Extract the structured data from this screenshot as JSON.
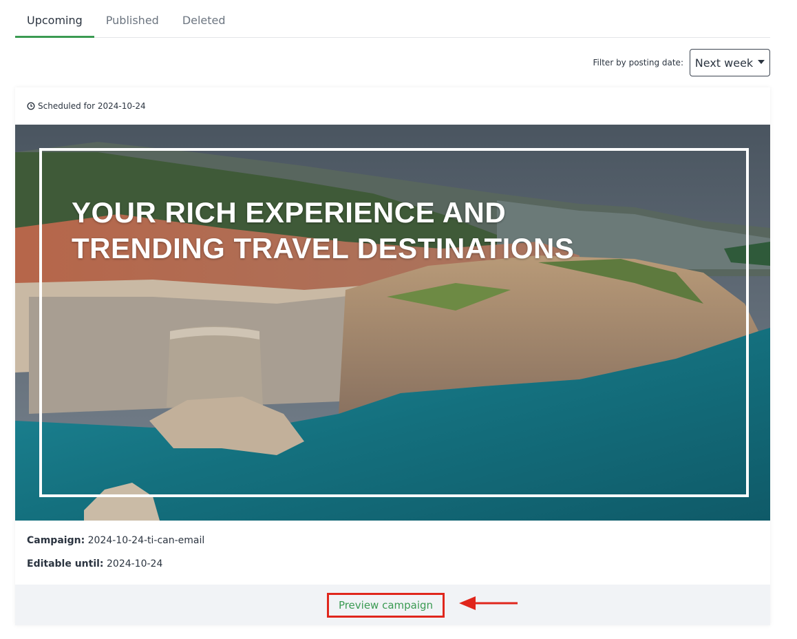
{
  "tabs": [
    {
      "label": "Upcoming",
      "active": true
    },
    {
      "label": "Published",
      "active": false
    },
    {
      "label": "Deleted",
      "active": false
    }
  ],
  "filter": {
    "label": "Filter by posting date:",
    "selected": "Next week"
  },
  "card": {
    "scheduled": "Scheduled for 2024-10-24",
    "hero": {
      "line1": "YOUR RICH EXPERIENCE AND",
      "line2": "TRENDING TRAVEL DESTINATIONS"
    },
    "campaign_label": "Campaign:",
    "campaign_value": "2024-10-24-ti-can-email",
    "editable_label": "Editable until:",
    "editable_value": "2024-10-24",
    "preview_label": "Preview campaign"
  },
  "colors": {
    "accent": "#3a9a52",
    "highlight": "#e0261c"
  }
}
